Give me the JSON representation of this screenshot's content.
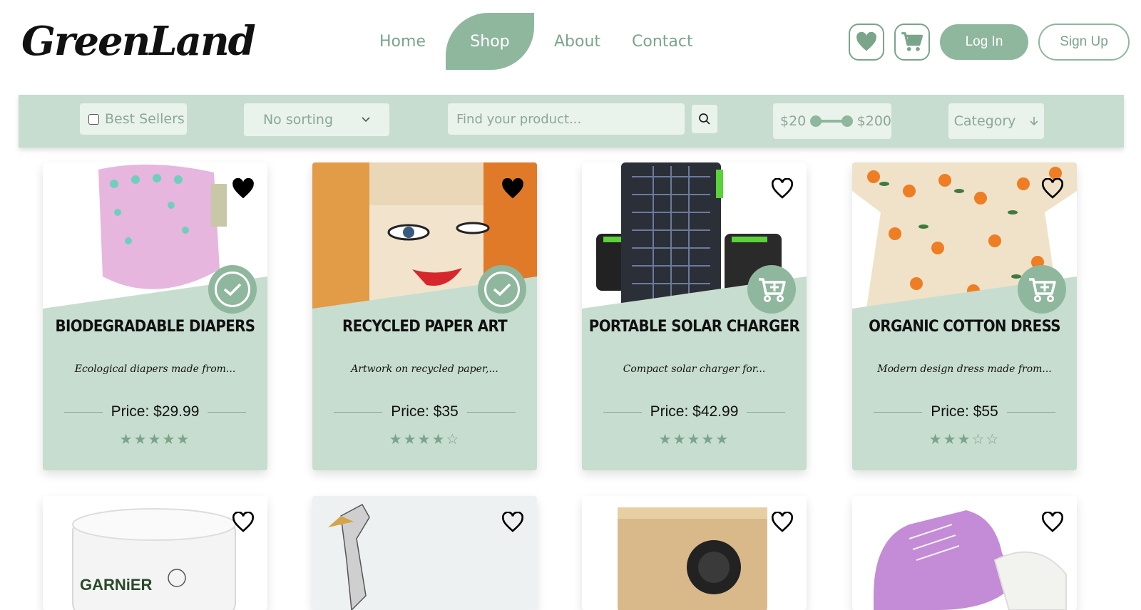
{
  "brand": {
    "name": "GreenLand"
  },
  "nav": {
    "items": [
      {
        "label": "Home",
        "active": false
      },
      {
        "label": "Shop",
        "active": true
      },
      {
        "label": "About",
        "active": false
      },
      {
        "label": "Contact",
        "active": false
      }
    ]
  },
  "header_actions": {
    "wishlist_icon": "heart-icon",
    "cart_icon": "cart-icon",
    "login_label": "Log In",
    "signup_label": "Sign Up"
  },
  "filters": {
    "best_sellers_label": "Best Sellers",
    "best_sellers_checked": false,
    "sorting_selected": "No sorting",
    "search_placeholder": "Find your product...",
    "price_min": "$20",
    "price_max": "$200",
    "category_label": "Category"
  },
  "colors": {
    "accent": "#8fb79d",
    "card_bg": "#c7ddcf",
    "text_green": "#7aa58b"
  },
  "products": [
    {
      "title": "BIODEGRADABLE DIAPERS",
      "desc": "Ecological diapers made from...",
      "price": "Price: $29.99",
      "rating": 5,
      "favorited": true,
      "in_cart": true
    },
    {
      "title": "RECYCLED PAPER ART",
      "desc": "Artwork on recycled paper,...",
      "price": "Price: $35",
      "rating": 4,
      "favorited": true,
      "in_cart": true
    },
    {
      "title": "PORTABLE SOLAR CHARGER",
      "desc": "Compact solar charger for...",
      "price": "Price: $42.99",
      "rating": 5,
      "favorited": false,
      "in_cart": false
    },
    {
      "title": "ORGANIC COTTON DRESS",
      "desc": "Modern design dress made from...",
      "price": "Price: $55",
      "rating": 3,
      "favorited": false,
      "in_cart": false
    }
  ],
  "products_row2": [
    {
      "favorited": false,
      "image_text": "GARNiER"
    },
    {
      "favorited": false
    },
    {
      "favorited": false
    },
    {
      "favorited": false
    }
  ]
}
